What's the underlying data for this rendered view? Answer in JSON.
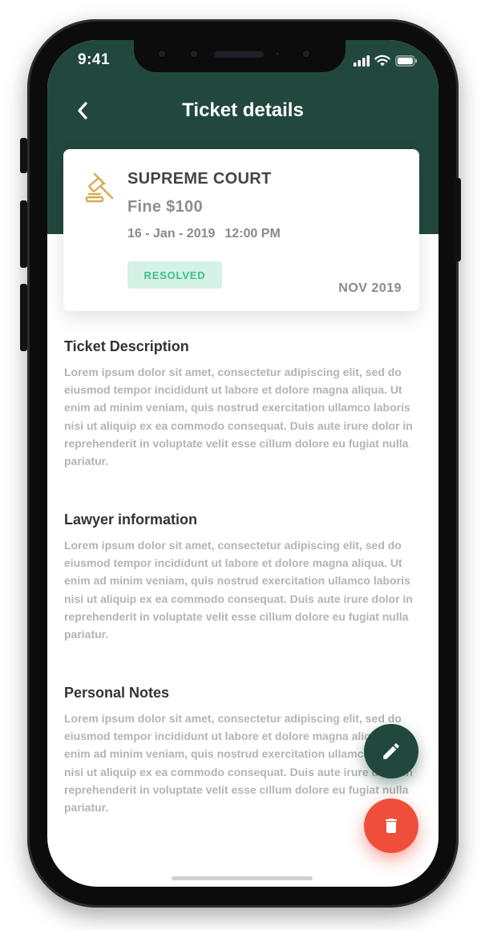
{
  "status_bar": {
    "time": "9:41"
  },
  "nav": {
    "title": "Ticket details"
  },
  "ticket": {
    "court": "SUPREME COURT",
    "fine": "Fine $100",
    "date": "16 - Jan - 2019",
    "time": "12:00 PM",
    "status": "RESOLVED",
    "month": "NOV 2019"
  },
  "sections": [
    {
      "title": "Ticket Description",
      "body": "Lorem ipsum dolor sit amet, consectetur adipiscing elit, sed do eiusmod tempor incididunt ut labore et dolore magna aliqua. Ut enim ad minim veniam, quis nostrud exercitation ullamco laboris nisi ut aliquip ex ea commodo consequat. Duis aute irure dolor in reprehenderit in voluptate velit esse cillum dolore eu fugiat nulla pariatur."
    },
    {
      "title": "Lawyer information",
      "body": "Lorem ipsum dolor sit amet, consectetur adipiscing elit, sed do eiusmod tempor incididunt ut labore et dolore magna aliqua. Ut enim ad minim veniam, quis nostrud exercitation ullamco laboris nisi ut aliquip ex ea commodo consequat. Duis aute irure dolor in reprehenderit in voluptate velit esse cillum dolore eu fugiat nulla pariatur."
    },
    {
      "title": "Personal Notes",
      "body": "Lorem ipsum dolor sit amet, consectetur adipiscing elit, sed do eiusmod tempor incididunt ut labore et dolore magna aliqua. Ut enim ad minim veniam, quis nostrud exercitation ullamco laboris nisi ut aliquip ex ea commodo consequat. Duis aute irure dolor in reprehenderit in voluptate velit esse cillum dolore eu fugiat nulla pariatur."
    }
  ],
  "icons": {
    "back": "chevron-left-icon",
    "gavel": "gavel-icon",
    "edit": "pencil-icon",
    "delete": "trash-icon",
    "signal": "signal-icon",
    "wifi": "wifi-icon",
    "battery": "battery-icon"
  },
  "colors": {
    "header": "#22483d",
    "status_badge_bg": "#d4f2e5",
    "status_badge_text": "#3fbf8a",
    "delete_fab": "#ef4f3a",
    "gavel": "#d8ab4f"
  }
}
